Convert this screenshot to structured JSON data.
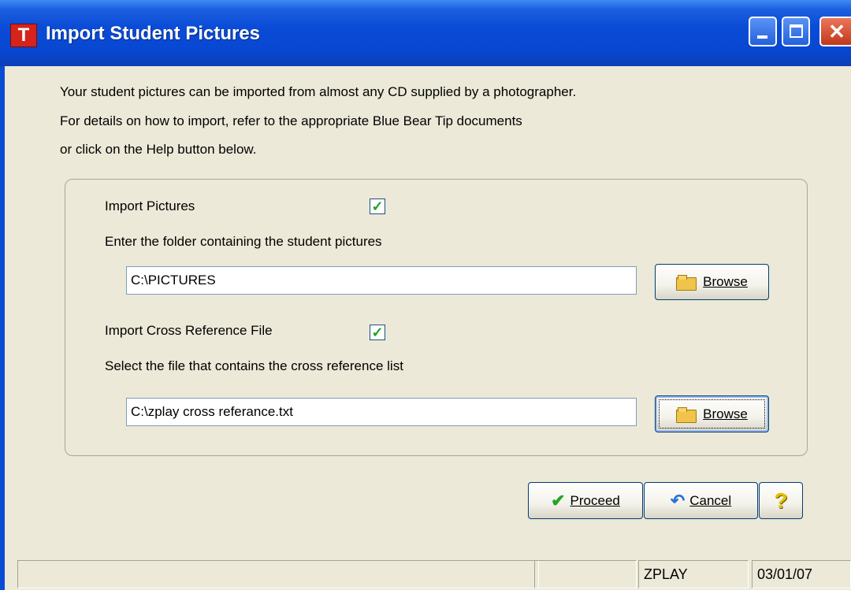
{
  "window": {
    "title": "Import Student Pictures",
    "app_icon_letter": "T"
  },
  "intro": {
    "line1": "Your student pictures can be imported from almost any CD supplied by a photographer.",
    "line2": "For details on how to import, refer to the appropriate Blue Bear Tip documents",
    "line3": "or click on the Help button below."
  },
  "pictures": {
    "checkbox_label": "Import Pictures",
    "checked": true,
    "folder_prompt": "Enter the folder containing the student pictures",
    "folder_value": "C:\\PICTURES",
    "browse_label": "Browse"
  },
  "crossref": {
    "checkbox_label": "Import Cross Reference File",
    "checked": true,
    "file_prompt": "Select the file that contains the cross reference list",
    "file_value": "C:\\zplay cross referance.txt",
    "browse_label": "Browse"
  },
  "actions": {
    "proceed_label": "Proceed",
    "cancel_label": "Cancel",
    "help_label": "?"
  },
  "statusbar": {
    "user": "ZPLAY",
    "date": "03/01/07"
  },
  "icons": {
    "titlebar": [
      "minimize-icon",
      "maximize-icon",
      "close-icon"
    ],
    "browse": "folder-icon",
    "proceed": "checkmark-icon",
    "cancel": "undo-arrow-icon",
    "help": "question-mark-icon"
  },
  "colors": {
    "titlebar": "#0a4cd6",
    "dialog_bg": "#ece9d8",
    "close_button": "#c2381b",
    "checkmark": "#21a121"
  }
}
